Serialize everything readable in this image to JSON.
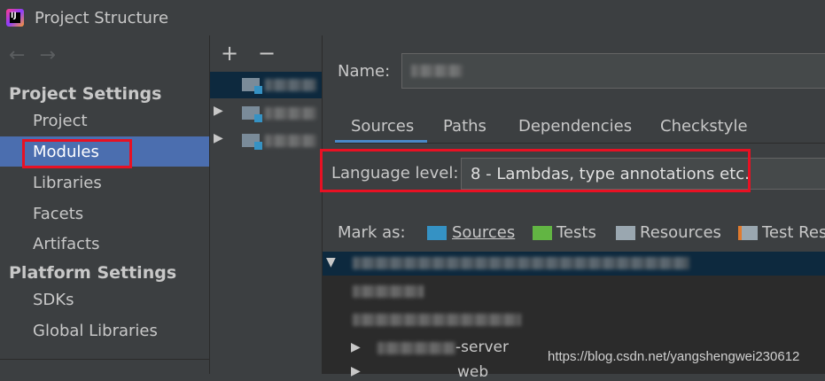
{
  "window": {
    "title": "Project Structure"
  },
  "sidebar": {
    "project_settings_header": "Project Settings",
    "items": [
      {
        "label": "Project"
      },
      {
        "label": "Modules",
        "selected": true
      },
      {
        "label": "Libraries"
      },
      {
        "label": "Facets"
      },
      {
        "label": "Artifacts"
      }
    ],
    "platform_settings_header": "Platform Settings",
    "platform_items": [
      {
        "label": "SDKs"
      },
      {
        "label": "Global Libraries"
      }
    ]
  },
  "toolbar": {
    "add_label": "+",
    "remove_label": "−"
  },
  "module_editor": {
    "name_label": "Name:",
    "tabs": [
      {
        "label": "Sources",
        "active": true
      },
      {
        "label": "Paths"
      },
      {
        "label": "Dependencies"
      },
      {
        "label": "Checkstyle"
      }
    ],
    "language_level_label": "Language level:",
    "language_level_value": "8 - Lambdas, type annotations etc.",
    "mark_as_label": "Mark as:",
    "mark_options": [
      {
        "label": "Sources",
        "icon": "sources-folder-icon",
        "color": "#3592c4"
      },
      {
        "label": "Tests",
        "icon": "tests-folder-icon",
        "color": "#62b543"
      },
      {
        "label": "Resources",
        "icon": "resources-folder-icon",
        "color": "#9aa7b0"
      },
      {
        "label": "Test Res",
        "icon": "test-resources-folder-icon",
        "color": "#9aa7b0"
      }
    ],
    "tree_partial_item": "-server",
    "tree_partial_item2": "web"
  },
  "watermark": "https://blog.csdn.net/yangshengwei230612",
  "colors": {
    "selection": "#4b6eaf",
    "highlight_box": "#e81123",
    "tab_underline": "#4a88c7"
  }
}
